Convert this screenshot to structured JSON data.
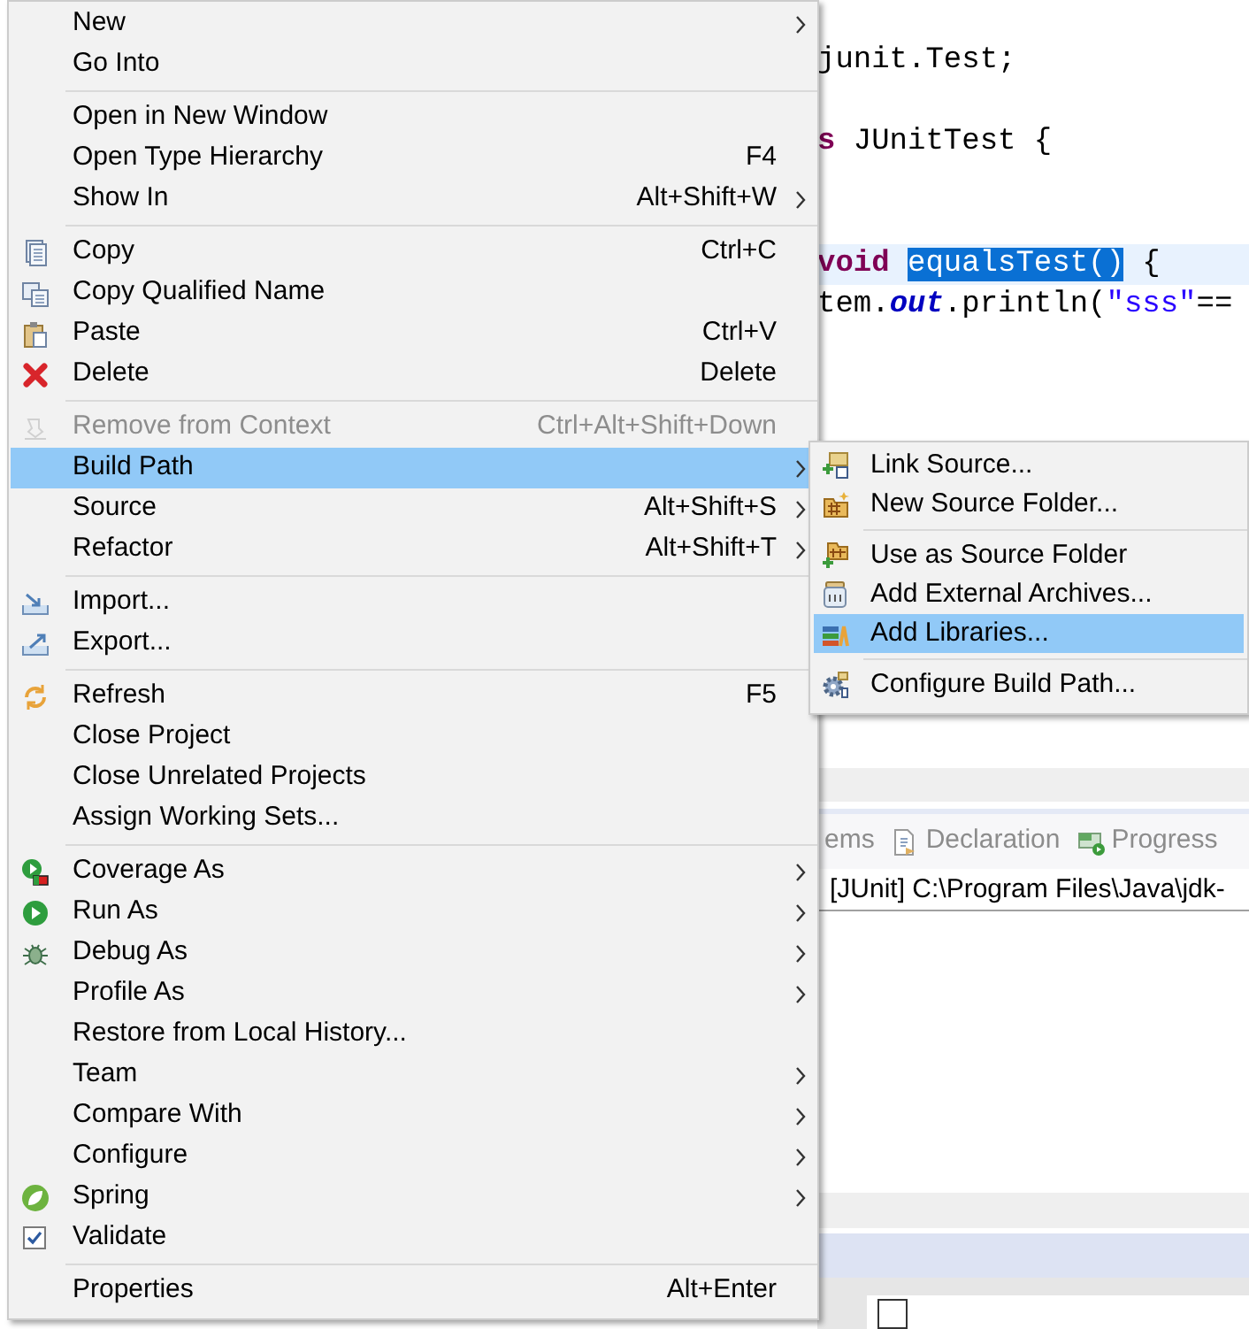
{
  "editor": {
    "lines": [
      {
        "current": false,
        "segments": [
          {
            "kind": "plain",
            "text": "junit.Test;"
          }
        ]
      },
      {
        "current": false,
        "segments": [
          {
            "kind": "keyword",
            "text": "s"
          },
          {
            "kind": "plain",
            "text": " JUnitTest {"
          }
        ]
      },
      {
        "current": true,
        "segments": [
          {
            "kind": "keyword",
            "text": "void"
          },
          {
            "kind": "selection",
            "text": "equalsTest()"
          },
          {
            "kind": "plain",
            "text": " {"
          }
        ]
      },
      {
        "current": false,
        "segments": [
          {
            "kind": "plain",
            "text": "tem."
          },
          {
            "kind": "field",
            "text": "out"
          },
          {
            "kind": "plain",
            "text": ".println("
          },
          {
            "kind": "string",
            "text": "\"sss\""
          },
          {
            "kind": "plain",
            "text": "=="
          }
        ]
      }
    ]
  },
  "view_tabs": [
    {
      "label": "ems",
      "kind": "plain",
      "selected": false
    },
    {
      "label": "Declaration",
      "kind": "declaration",
      "selected": false
    },
    {
      "label": "Progress",
      "kind": "progress",
      "selected": false
    }
  ],
  "console": {
    "text": "[JUnit] C:\\Program Files\\Java\\jdk-"
  },
  "bottom_checkbox": {
    "checked": false
  },
  "menu": {
    "groups": [
      {
        "items": [
          {
            "label": "New",
            "kind": "plain",
            "submenu": true,
            "selected": false,
            "disabled": false
          },
          {
            "label": "Go Into",
            "kind": "plain",
            "submenu": false,
            "selected": false,
            "disabled": false
          }
        ]
      },
      {
        "items": [
          {
            "label": "Open in New Window",
            "kind": "plain",
            "submenu": false,
            "selected": false,
            "disabled": false
          },
          {
            "label": "Open Type Hierarchy",
            "shortcut": "F4",
            "kind": "plain",
            "submenu": false,
            "selected": false,
            "disabled": false
          },
          {
            "label": "Show In",
            "shortcut": "Alt+Shift+W",
            "kind": "plain",
            "submenu": true,
            "selected": false,
            "disabled": false
          }
        ]
      },
      {
        "items": [
          {
            "label": "Copy",
            "shortcut": "Ctrl+C",
            "kind": "copy",
            "submenu": false,
            "selected": false,
            "disabled": false
          },
          {
            "label": "Copy Qualified Name",
            "kind": "copy-qualified",
            "submenu": false,
            "selected": false,
            "disabled": false
          },
          {
            "label": "Paste",
            "shortcut": "Ctrl+V",
            "kind": "paste",
            "submenu": false,
            "selected": false,
            "disabled": false
          },
          {
            "label": "Delete",
            "shortcut": "Delete",
            "kind": "delete",
            "submenu": false,
            "selected": false,
            "disabled": false
          }
        ]
      },
      {
        "items": [
          {
            "label": "Remove from Context",
            "shortcut": "Ctrl+Alt+Shift+Down",
            "kind": "remove",
            "submenu": false,
            "selected": false,
            "disabled": true
          },
          {
            "label": "Build Path",
            "kind": "plain",
            "submenu": true,
            "selected": true,
            "disabled": false
          },
          {
            "label": "Source",
            "shortcut": "Alt+Shift+S",
            "kind": "plain",
            "submenu": true,
            "selected": false,
            "disabled": false
          },
          {
            "label": "Refactor",
            "shortcut": "Alt+Shift+T",
            "kind": "plain",
            "submenu": true,
            "selected": false,
            "disabled": false
          }
        ]
      },
      {
        "items": [
          {
            "label": "Import...",
            "kind": "import",
            "submenu": false,
            "selected": false,
            "disabled": false
          },
          {
            "label": "Export...",
            "kind": "export",
            "submenu": false,
            "selected": false,
            "disabled": false
          }
        ]
      },
      {
        "items": [
          {
            "label": "Refresh",
            "shortcut": "F5",
            "kind": "refresh",
            "submenu": false,
            "selected": false,
            "disabled": false
          },
          {
            "label": "Close Project",
            "kind": "plain",
            "submenu": false,
            "selected": false,
            "disabled": false
          },
          {
            "label": "Close Unrelated Projects",
            "kind": "plain",
            "submenu": false,
            "selected": false,
            "disabled": false
          },
          {
            "label": "Assign Working Sets...",
            "kind": "plain",
            "submenu": false,
            "selected": false,
            "disabled": false
          }
        ]
      },
      {
        "items": [
          {
            "label": "Coverage As",
            "kind": "coverage",
            "submenu": true,
            "selected": false,
            "disabled": false
          },
          {
            "label": "Run As",
            "kind": "run",
            "submenu": true,
            "selected": false,
            "disabled": false
          },
          {
            "label": "Debug As",
            "kind": "debug",
            "submenu": true,
            "selected": false,
            "disabled": false
          },
          {
            "label": "Profile As",
            "kind": "plain",
            "submenu": true,
            "selected": false,
            "disabled": false
          },
          {
            "label": "Restore from Local History...",
            "kind": "plain",
            "submenu": false,
            "selected": false,
            "disabled": false
          },
          {
            "label": "Team",
            "kind": "plain",
            "submenu": true,
            "selected": false,
            "disabled": false
          },
          {
            "label": "Compare With",
            "kind": "plain",
            "submenu": true,
            "selected": false,
            "disabled": false
          },
          {
            "label": "Configure",
            "kind": "plain",
            "submenu": true,
            "selected": false,
            "disabled": false
          },
          {
            "label": "Spring",
            "kind": "spring",
            "submenu": true,
            "selected": false,
            "disabled": false
          },
          {
            "label": "Validate",
            "kind": "validate",
            "submenu": false,
            "selected": false,
            "disabled": false
          }
        ]
      },
      {
        "items": [
          {
            "label": "Properties",
            "shortcut": "Alt+Enter",
            "kind": "plain",
            "submenu": false,
            "selected": false,
            "disabled": false
          }
        ]
      }
    ]
  },
  "submenu": {
    "groups": [
      {
        "items": [
          {
            "label": "Link Source...",
            "kind": "link-source",
            "selected": false
          },
          {
            "label": "New Source Folder...",
            "kind": "new-folder",
            "selected": false
          }
        ]
      },
      {
        "items": [
          {
            "label": "Use as Source Folder",
            "kind": "use-folder",
            "selected": false
          },
          {
            "label": "Add External Archives...",
            "kind": "archive",
            "selected": false
          },
          {
            "label": "Add Libraries...",
            "kind": "libraries",
            "selected": true
          }
        ]
      },
      {
        "items": [
          {
            "label": "Configure Build Path...",
            "kind": "configure",
            "selected": false
          }
        ]
      }
    ]
  }
}
